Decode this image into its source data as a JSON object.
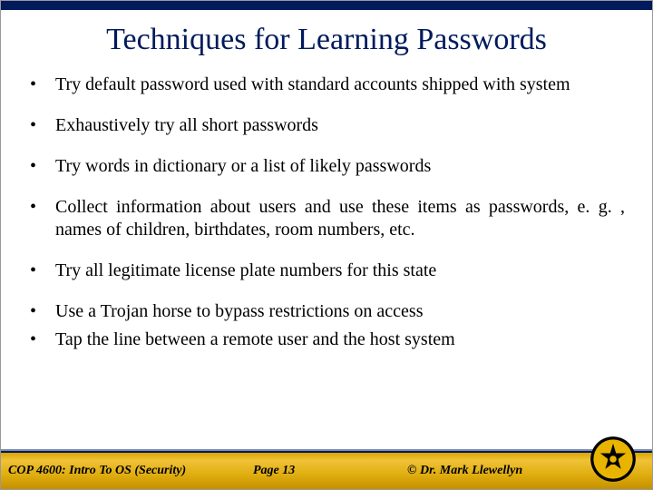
{
  "slide": {
    "title": "Techniques for Learning Passwords",
    "bullets": [
      "Try default password used with standard accounts shipped with system",
      "Exhaustively try all short passwords",
      "Try words in dictionary or a list of likely passwords",
      "Collect information about users and use these items as passwords, e. g. , names of children, birthdates, room numbers, etc.",
      "Try all legitimate license plate numbers for this state",
      "Use a Trojan horse to bypass restrictions on access",
      "Tap the line between a remote user and the host system"
    ]
  },
  "footer": {
    "course": "COP 4600: Intro To OS  (Security)",
    "page": "Page 13",
    "copyright": "© Dr. Mark Llewellyn"
  }
}
